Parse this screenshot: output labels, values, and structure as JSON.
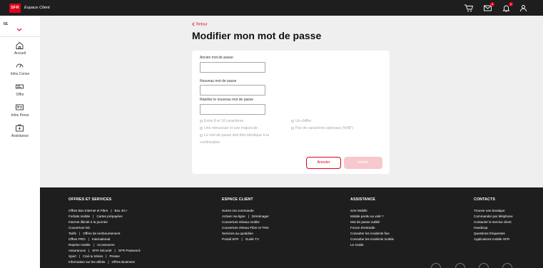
{
  "header": {
    "logo": "SFR",
    "brand": "Espace Client",
    "notifications": {
      "mail_badge": "1",
      "bell_badge": "1"
    }
  },
  "sidebar": {
    "account": "01",
    "items": [
      {
        "label": "Accueil",
        "icon": "home-icon"
      },
      {
        "label": "Infos Conso",
        "icon": "gauge-icon"
      },
      {
        "label": "Offre",
        "icon": "sim-icon"
      },
      {
        "label": "Infos Perso",
        "icon": "id-card-icon"
      },
      {
        "label": "Assistance",
        "icon": "first-aid-icon"
      }
    ]
  },
  "main": {
    "back_label": "Retour",
    "title": "Modifier mon mot de passe",
    "form": {
      "old_label": "Ancien mot de passe",
      "new_label": "Nouveau mot de passe",
      "repeat_label": "Répéter le nouveau mot de passe",
      "old_value": "",
      "new_value": "",
      "repeat_value": "",
      "rules": [
        "Entre 8 et 16 caractères",
        "Un chiffre",
        "Une minuscule et une majuscule",
        "Pas de caractères spéciaux (%#$*)",
        "Le mot de passe doit être identique à la confirmation"
      ],
      "cancel_label": "Annuler",
      "validate_label": "Valider"
    }
  },
  "footer": {
    "offres": {
      "title": "OFFRES ET SERVICES",
      "lines": [
        [
          "Offres Box Internet et Fibre",
          "Box 4G+"
        ],
        [
          "Forfaits mobile",
          "Cartes prépayées"
        ],
        [
          "Internet illimité à la journée"
        ],
        [
          "Couverture 5G"
        ],
        [
          "Tarifs",
          "Offres de remboursement"
        ],
        [
          "Offres PRO",
          "International"
        ],
        [
          "Reprise mobile",
          "Accessoires"
        ],
        [
          "Assurances",
          "SFR Sécurité",
          "SFR Password"
        ],
        [
          "Sport",
          "Ciné & Séries",
          "Presse"
        ],
        [
          "Information sur les débits",
          "Offres Business"
        ]
      ]
    },
    "espace": {
      "title": "ESPACE CLIENT",
      "lines": [
        [
          "Suivre ma commande"
        ],
        [
          "Activer ma ligne",
          "Déménager"
        ],
        [
          "Couverture réseau mobile"
        ],
        [
          "Couverture réseau Fibre et THD"
        ],
        [
          "Services au quotidien"
        ],
        [
          "Portail SFR",
          "Guide TV"
        ]
      ]
    },
    "assistance": {
      "title": "ASSISTANCE",
      "lines": [
        [
          "SAV Mobile"
        ],
        [
          "Mobile perdu ou volé ?"
        ],
        [
          "Mot de passe oublié"
        ],
        [
          "Forum d'entraide"
        ],
        [
          "Consulter les incidents fixe"
        ],
        [
          "Consulter les incidents mobile"
        ],
        [
          "Le Guide"
        ]
      ]
    },
    "contacts": {
      "title": "CONTACTS",
      "lines": [
        [
          "Trouver une boutique"
        ],
        [
          "Commander par téléphone"
        ],
        [
          "Contacter le service client"
        ],
        [
          "Handicap"
        ],
        [
          "Questions fréquentes"
        ],
        [
          "Applications mobile SFR"
        ]
      ]
    }
  },
  "colors": {
    "brand_red": "#e2001a",
    "dark": "#1e1e1e",
    "bg": "#efefef"
  }
}
